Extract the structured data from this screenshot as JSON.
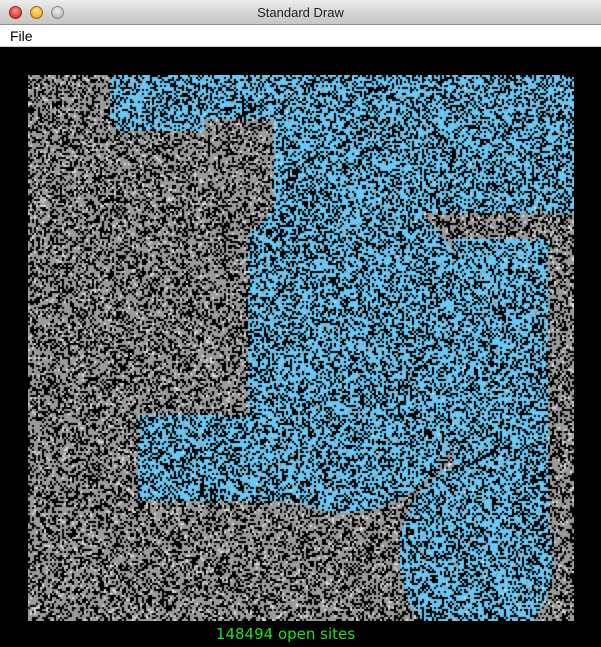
{
  "window": {
    "title": "Standard Draw",
    "controls": [
      "close",
      "minimize",
      "zoom"
    ]
  },
  "menu": {
    "items": [
      {
        "label": "File"
      }
    ]
  },
  "grid": {
    "colors": {
      "blocked": "#000000",
      "open": "#9a9a9a",
      "full": "#6ac6f2",
      "background": "#000000"
    }
  },
  "status": {
    "open_sites_text": "148494 open sites",
    "text_color": "#22e022"
  }
}
